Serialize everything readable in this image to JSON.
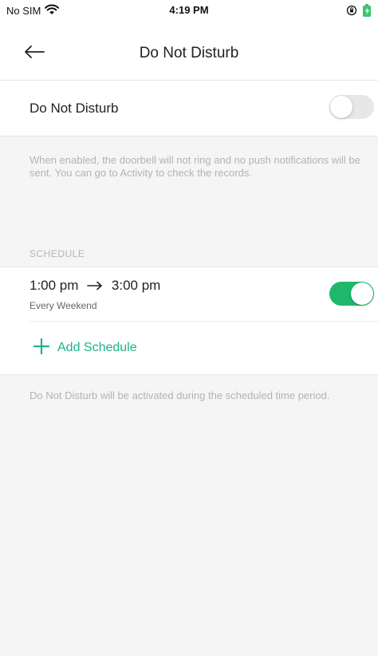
{
  "status_bar": {
    "carrier": "No SIM",
    "time": "4:19 PM"
  },
  "header": {
    "title": "Do Not Disturb"
  },
  "dnd": {
    "label": "Do Not Disturb",
    "enabled": false,
    "description": "When enabled, the doorbell will not ring and no push notifications will be sent. You can go to Activity to check the records."
  },
  "schedule": {
    "section_title": "SCHEDULE",
    "items": [
      {
        "start": "1:00 pm",
        "end": "3:00 pm",
        "repeat": "Every Weekend",
        "enabled": true
      }
    ],
    "add_label": "Add Schedule",
    "footer_note": "Do Not Disturb will be activated during the scheduled time period."
  },
  "colors": {
    "accent": "#1db28a",
    "toggle_on": "#1fb86a",
    "toggle_off": "#e7e7e7"
  },
  "icons": [
    "wifi-icon",
    "orientation-lock-icon",
    "battery-charging-icon",
    "back-arrow-icon",
    "right-arrow-icon",
    "plus-icon"
  ]
}
